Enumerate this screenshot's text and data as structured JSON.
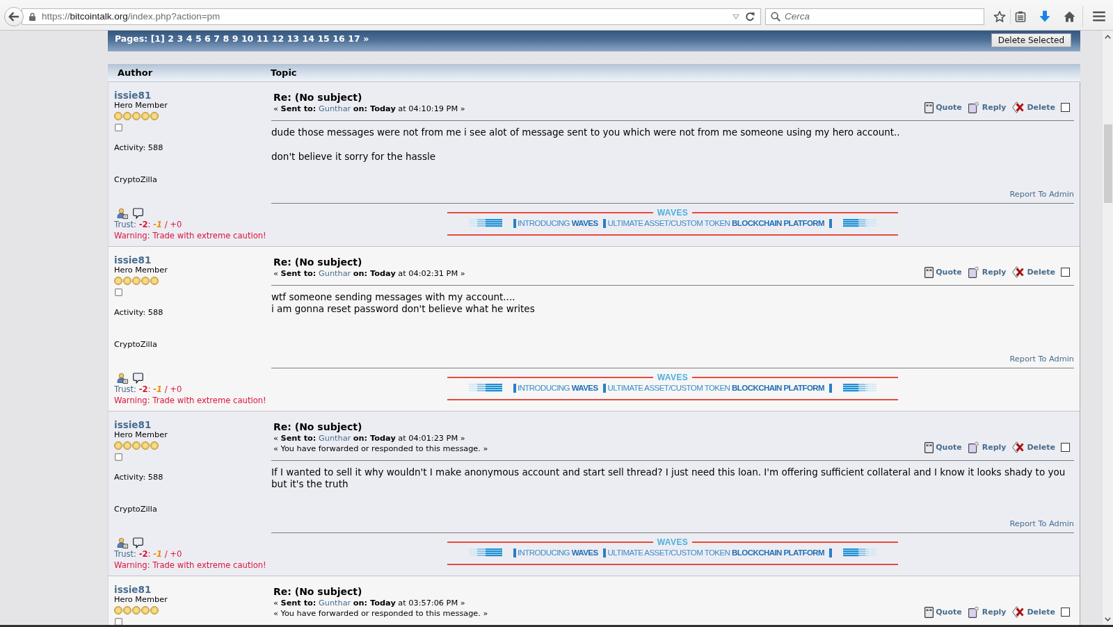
{
  "browser": {
    "url": {
      "scheme": "https://",
      "host": "bitcointalk.org",
      "path": "/index.php?action=pm"
    },
    "search": {
      "placeholder": "Cerca"
    }
  },
  "pages_bar": {
    "label": "Pages:",
    "pages": [
      "[1]",
      "2",
      "3",
      "4",
      "5",
      "6",
      "7",
      "8",
      "9",
      "10",
      "11",
      "12",
      "13",
      "14",
      "15",
      "16",
      "17",
      "»"
    ],
    "button": "Delete Selected"
  },
  "columns": [
    "Author",
    "Topic"
  ],
  "posts": [
    {
      "author": {
        "name": "issie81",
        "rank": "Hero Member",
        "stars": 5,
        "activity": "Activity: 588",
        "custom_title": "CryptoZilla",
        "trust": {
          "label": "Trust:",
          "score": "**-2**:",
          "negative": "-1",
          "positive": "/ +0"
        },
        "warning": "Warning: Trade with extreme caution!"
      },
      "message": {
        "subject": "Re: (No subject)",
        "sent_label": "« **Sent to:**",
        "recipient": "Gunthar",
        "date": "**on: Today** at 04:10:19 PM »",
        "actions": [
          {
            "kind": "quote",
            "label": "Quote"
          },
          {
            "kind": "reply",
            "label": "Reply"
          },
          {
            "kind": "delete",
            "label": "Delete"
          }
        ],
        "checked": false,
        "body": [
          [
            "dude those messages were not from me i see alot of message sent to you which were not from me someone using my hero account.."
          ],
          [
            "don't believe it sorry for the hassle"
          ]
        ],
        "report": "Report To Admin",
        "signature": {
          "title": "WAVES",
          "tagline": "INTRODUCING **WAVES**",
          "text": "ULTIMATE ASSET/CUSTOM TOKEN **BLOCKCHAIN PLATFORM**"
        }
      }
    },
    {
      "author": {
        "name": "issie81",
        "rank": "Hero Member",
        "stars": 5,
        "activity": "Activity: 588",
        "custom_title": "CryptoZilla",
        "trust": {
          "label": "Trust:",
          "score": "**-2**:",
          "negative": "-1",
          "positive": "/ +0"
        },
        "warning": "Warning: Trade with extreme caution!"
      },
      "message": {
        "subject": "Re: (No subject)",
        "sent_label": "« **Sent to:**",
        "recipient": "Gunthar",
        "date": "**on: Today** at 04:02:31 PM »",
        "actions": [
          {
            "kind": "quote",
            "label": "Quote"
          },
          {
            "kind": "reply",
            "label": "Reply"
          },
          {
            "kind": "delete",
            "label": "Delete"
          }
        ],
        "checked": false,
        "body": [
          [
            "wtf someone sending messages with my account....",
            "i am gonna reset password don't believe what he writes"
          ]
        ],
        "report": "Report To Admin",
        "signature": {
          "title": "WAVES",
          "tagline": "INTRODUCING **WAVES**",
          "text": "ULTIMATE ASSET/CUSTOM TOKEN **BLOCKCHAIN PLATFORM**"
        }
      }
    },
    {
      "author": {
        "name": "issie81",
        "rank": "Hero Member",
        "stars": 5,
        "activity": "Activity: 588",
        "custom_title": "CryptoZilla",
        "trust": {
          "label": "Trust:",
          "score": "**-2**:",
          "negative": "-1",
          "positive": "/ +0"
        },
        "warning": "Warning: Trade with extreme caution!"
      },
      "message": {
        "subject": "Re: (No subject)",
        "sent_label": "« **Sent to:**",
        "recipient": "Gunthar",
        "date": "**on: Today** at 04:01:23 PM »",
        "forwarded": "« You have forwarded or responded to this message. »",
        "actions": [
          {
            "kind": "quote",
            "label": "Quote"
          },
          {
            "kind": "reply",
            "label": "Reply"
          },
          {
            "kind": "delete",
            "label": "Delete"
          }
        ],
        "checked": false,
        "body": [
          [
            "If I wanted to sell it why wouldn't I make anonymous account and start sell thread? I just need this loan. I'm offering sufficient collateral and I know it looks shady to you but it's the truth"
          ]
        ],
        "report": "Report To Admin",
        "signature": {
          "title": "WAVES",
          "tagline": "INTRODUCING **WAVES**",
          "text": "ULTIMATE ASSET/CUSTOM TOKEN **BLOCKCHAIN PLATFORM**"
        }
      }
    },
    {
      "author": {
        "name": "issie81",
        "rank": "Hero Member",
        "stars": 5
      },
      "message": {
        "subject": "Re: (No subject)",
        "sent_label": "« **Sent to:**",
        "recipient": "Gunthar",
        "date": "**on: Today** at 03:57:06 PM »",
        "forwarded": "« You have forwarded or responded to this message. »",
        "actions": [
          {
            "kind": "quote",
            "label": "Quote"
          },
          {
            "kind": "reply",
            "label": "Reply"
          },
          {
            "kind": "delete",
            "label": "Delete"
          }
        ],
        "checked": false
      }
    }
  ]
}
